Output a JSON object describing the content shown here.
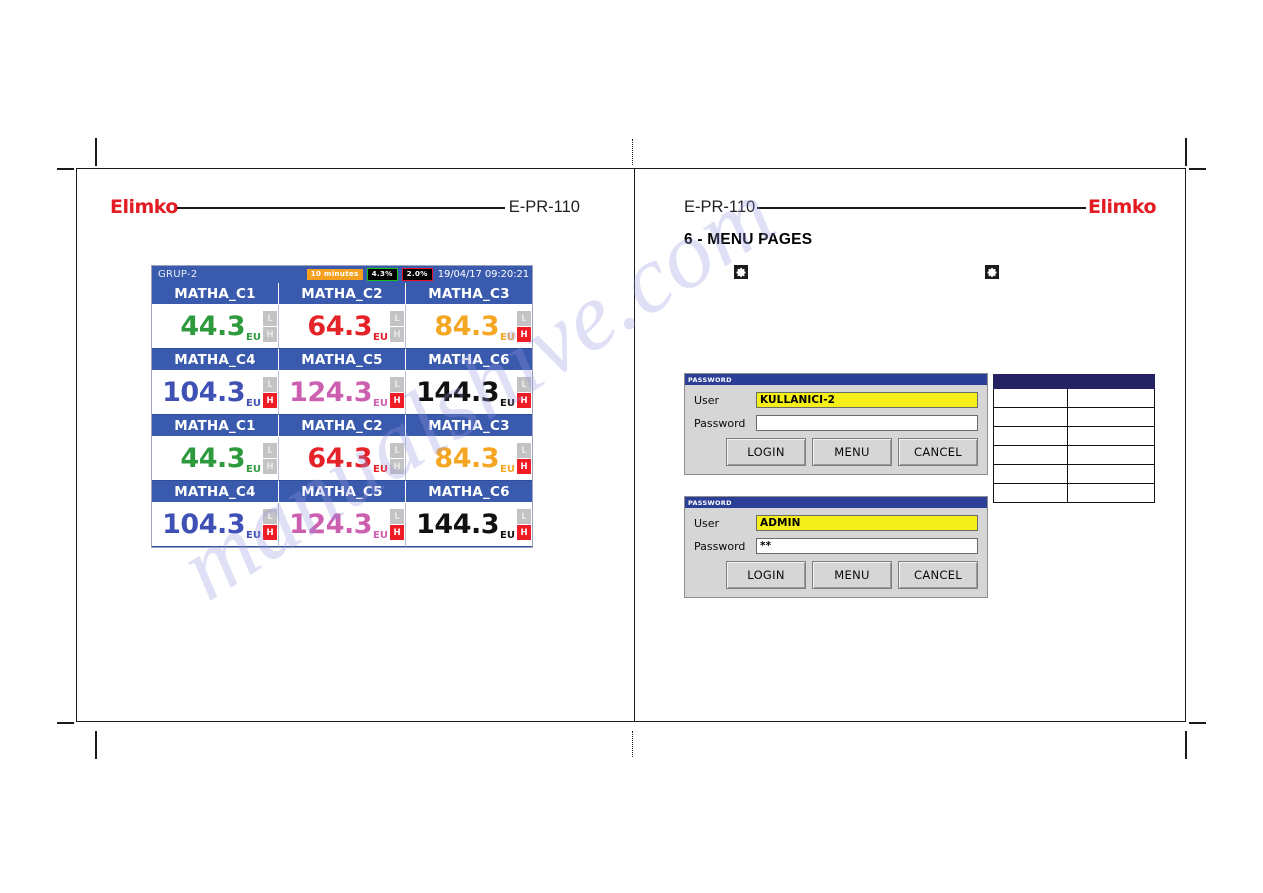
{
  "document": {
    "watermark_text": "manualshive.com",
    "brand": "Elimko",
    "model_code": "E-PR-110",
    "section_title": "6 - MENU PAGES"
  },
  "device_screen": {
    "group_label": "GRUP-2",
    "badges": [
      {
        "name": "interval",
        "text": "10 minutes",
        "bg": "#f5a01e",
        "fg": "#ffffff"
      },
      {
        "name": "pv-green",
        "text": "4.3%",
        "bg": "#000000",
        "border": "#19c219"
      },
      {
        "name": "pv-red",
        "text": "2.0%",
        "bg": "#000000",
        "border": "#e8102a"
      }
    ],
    "datetime": "19/04/17 09:20:21",
    "unit_label": "EU",
    "low_label": "L",
    "high_label": "H",
    "rows": [
      {
        "cells": [
          {
            "tag": "MATHA_C1",
            "value": "44.3",
            "unit": "EU",
            "color": "#2e9a3e",
            "low_alarm": false,
            "high_alarm": false
          },
          {
            "tag": "MATHA_C2",
            "value": "64.3",
            "unit": "EU",
            "color": "#e62229",
            "low_alarm": false,
            "high_alarm": false
          },
          {
            "tag": "MATHA_C3",
            "value": "84.3",
            "unit": "EU",
            "color": "#f5a623",
            "low_alarm": false,
            "high_alarm": true
          }
        ]
      },
      {
        "cells": [
          {
            "tag": "MATHA_C4",
            "value": "104.3",
            "unit": "EU",
            "color": "#3f51b5",
            "low_alarm": false,
            "high_alarm": true
          },
          {
            "tag": "MATHA_C5",
            "value": "124.3",
            "unit": "EU",
            "color": "#cc5fb0",
            "low_alarm": false,
            "high_alarm": true
          },
          {
            "tag": "MATHA_C6",
            "value": "144.3",
            "unit": "EU",
            "color": "#111111",
            "low_alarm": false,
            "high_alarm": true
          }
        ]
      },
      {
        "cells": [
          {
            "tag": "MATHA_C1",
            "value": "44.3",
            "unit": "EU",
            "color": "#2e9a3e",
            "low_alarm": false,
            "high_alarm": false
          },
          {
            "tag": "MATHA_C2",
            "value": "64.3",
            "unit": "EU",
            "color": "#e62229",
            "low_alarm": false,
            "high_alarm": false
          },
          {
            "tag": "MATHA_C3",
            "value": "84.3",
            "unit": "EU",
            "color": "#f5a623",
            "low_alarm": false,
            "high_alarm": true
          }
        ]
      },
      {
        "cells": [
          {
            "tag": "MATHA_C4",
            "value": "104.3",
            "unit": "EU",
            "color": "#3f51b5",
            "low_alarm": false,
            "high_alarm": true
          },
          {
            "tag": "MATHA_C5",
            "value": "124.3",
            "unit": "EU",
            "color": "#cc5fb0",
            "low_alarm": false,
            "high_alarm": true
          },
          {
            "tag": "MATHA_C6",
            "value": "144.3",
            "unit": "EU",
            "color": "#111111",
            "low_alarm": false,
            "high_alarm": true
          }
        ]
      }
    ]
  },
  "password_dialogs": [
    {
      "title": "PASSWORD",
      "user_label": "User",
      "user_value": "KULLANICI-2",
      "password_label": "Password",
      "password_value": "",
      "buttons": [
        "LOGIN",
        "MENU",
        "CANCEL"
      ]
    },
    {
      "title": "PASSWORD",
      "user_label": "User",
      "user_value": "ADMIN",
      "password_label": "Password",
      "password_value": "**",
      "buttons": [
        "LOGIN",
        "MENU",
        "CANCEL"
      ]
    }
  ],
  "side_table": {
    "columns": [
      "",
      ""
    ],
    "rows": [
      [
        "",
        ""
      ],
      [
        "",
        ""
      ],
      [
        "",
        ""
      ],
      [
        "",
        ""
      ],
      [
        "",
        ""
      ],
      [
        "",
        ""
      ]
    ]
  }
}
